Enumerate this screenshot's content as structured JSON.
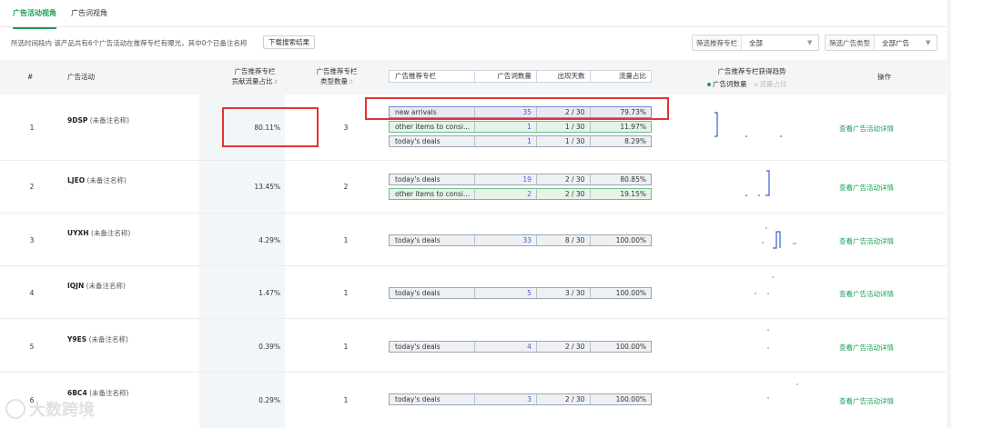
{
  "tabs": [
    {
      "label": "广告活动视角",
      "active": true
    },
    {
      "label": "广告词视角",
      "active": false
    }
  ],
  "info_text": "所选时间段内 该产品共有6个广告活动在推荐专栏有曝光，其中0个已备注名称",
  "download_button": "下载搜索结果",
  "filters": [
    {
      "label": "筛选推荐专栏",
      "value": "全部"
    },
    {
      "label": "筛选广告类型",
      "value": "全部广告"
    }
  ],
  "headers": {
    "index": "#",
    "campaign": "广告活动",
    "contribution_l1": "广告推荐专栏",
    "contribution_l2": "贡献流量占比",
    "types_l1": "广告推荐专栏",
    "types_l2": "类型数量",
    "sub": [
      "广告推荐专栏",
      "广告词数量",
      "出现天数",
      "流量占比"
    ],
    "trend": "广告推荐专栏获得趋势",
    "legend_a": "广告词数量",
    "legend_b": "流量占比",
    "action": "操作"
  },
  "colors": {
    "accent": "#1a9e55",
    "highlight": "#e53333",
    "link_blue": "#4a5bd4"
  },
  "rows": [
    {
      "index": "1",
      "code": "9DSP",
      "note": "(未备注名称)",
      "contribution": "80.11%",
      "type_count": "3",
      "action": "查看广告活动详情",
      "keywords": [
        {
          "name": "new arrivals",
          "count": "35",
          "days": "2 / 30",
          "share": "79.73%",
          "style": "blue"
        },
        {
          "name": "other items to consi...",
          "count": "1",
          "days": "1 / 30",
          "share": "11.97%",
          "style": "green"
        },
        {
          "name": "today's deals",
          "count": "1",
          "days": "1 / 30",
          "share": "8.29%",
          "style": "gray"
        }
      ]
    },
    {
      "index": "2",
      "code": "LJEO",
      "note": "(未备注名称)",
      "contribution": "13.45%",
      "type_count": "2",
      "action": "查看广告活动详情",
      "keywords": [
        {
          "name": "today's deals",
          "count": "19",
          "days": "2 / 30",
          "share": "80.85%",
          "style": "gray"
        },
        {
          "name": "other items to consi...",
          "count": "2",
          "days": "2 / 30",
          "share": "19.15%",
          "style": "green"
        }
      ]
    },
    {
      "index": "3",
      "code": "UYXH",
      "note": "(未备注名称)",
      "contribution": "4.29%",
      "type_count": "1",
      "action": "查看广告活动详情",
      "keywords": [
        {
          "name": "today's deals",
          "count": "33",
          "days": "8 / 30",
          "share": "100.00%",
          "style": "gray"
        }
      ]
    },
    {
      "index": "4",
      "code": "IQJN",
      "note": "(未备注名称)",
      "contribution": "1.47%",
      "type_count": "1",
      "action": "查看广告活动详情",
      "keywords": [
        {
          "name": "today's deals",
          "count": "5",
          "days": "3 / 30",
          "share": "100.00%",
          "style": "gray"
        }
      ]
    },
    {
      "index": "5",
      "code": "Y9ES",
      "note": "(未备注名称)",
      "contribution": "0.39%",
      "type_count": "1",
      "action": "查看广告活动详情",
      "keywords": [
        {
          "name": "today's deals",
          "count": "4",
          "days": "2 / 30",
          "share": "100.00%",
          "style": "gray"
        }
      ]
    },
    {
      "index": "6",
      "code": "6BC4",
      "note": "(未备注名称)",
      "contribution": "0.29%",
      "type_count": "1",
      "action": "查看广告活动详情",
      "keywords": [
        {
          "name": "today's deals",
          "count": "3",
          "days": "2 / 30",
          "share": "100.00%",
          "style": "gray"
        }
      ]
    }
  ],
  "watermark": "大数跨境"
}
